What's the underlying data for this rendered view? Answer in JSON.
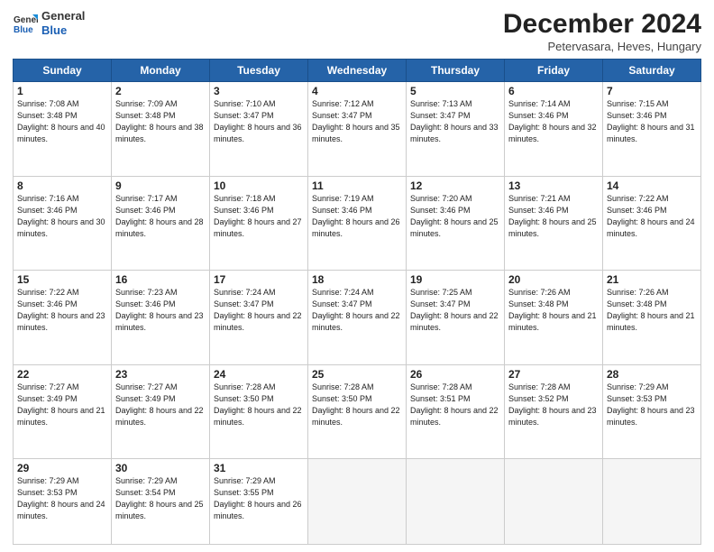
{
  "logo": {
    "line1": "General",
    "line2": "Blue"
  },
  "title": "December 2024",
  "subtitle": "Petervasara, Heves, Hungary",
  "header": {
    "days": [
      "Sunday",
      "Monday",
      "Tuesday",
      "Wednesday",
      "Thursday",
      "Friday",
      "Saturday"
    ]
  },
  "weeks": [
    [
      {
        "day": "1",
        "sunrise": "7:08 AM",
        "sunset": "3:48 PM",
        "daylight": "8 hours and 40 minutes."
      },
      {
        "day": "2",
        "sunrise": "7:09 AM",
        "sunset": "3:48 PM",
        "daylight": "8 hours and 38 minutes."
      },
      {
        "day": "3",
        "sunrise": "7:10 AM",
        "sunset": "3:47 PM",
        "daylight": "8 hours and 36 minutes."
      },
      {
        "day": "4",
        "sunrise": "7:12 AM",
        "sunset": "3:47 PM",
        "daylight": "8 hours and 35 minutes."
      },
      {
        "day": "5",
        "sunrise": "7:13 AM",
        "sunset": "3:47 PM",
        "daylight": "8 hours and 33 minutes."
      },
      {
        "day": "6",
        "sunrise": "7:14 AM",
        "sunset": "3:46 PM",
        "daylight": "8 hours and 32 minutes."
      },
      {
        "day": "7",
        "sunrise": "7:15 AM",
        "sunset": "3:46 PM",
        "daylight": "8 hours and 31 minutes."
      }
    ],
    [
      {
        "day": "8",
        "sunrise": "7:16 AM",
        "sunset": "3:46 PM",
        "daylight": "8 hours and 30 minutes."
      },
      {
        "day": "9",
        "sunrise": "7:17 AM",
        "sunset": "3:46 PM",
        "daylight": "8 hours and 28 minutes."
      },
      {
        "day": "10",
        "sunrise": "7:18 AM",
        "sunset": "3:46 PM",
        "daylight": "8 hours and 27 minutes."
      },
      {
        "day": "11",
        "sunrise": "7:19 AM",
        "sunset": "3:46 PM",
        "daylight": "8 hours and 26 minutes."
      },
      {
        "day": "12",
        "sunrise": "7:20 AM",
        "sunset": "3:46 PM",
        "daylight": "8 hours and 25 minutes."
      },
      {
        "day": "13",
        "sunrise": "7:21 AM",
        "sunset": "3:46 PM",
        "daylight": "8 hours and 25 minutes."
      },
      {
        "day": "14",
        "sunrise": "7:22 AM",
        "sunset": "3:46 PM",
        "daylight": "8 hours and 24 minutes."
      }
    ],
    [
      {
        "day": "15",
        "sunrise": "7:22 AM",
        "sunset": "3:46 PM",
        "daylight": "8 hours and 23 minutes."
      },
      {
        "day": "16",
        "sunrise": "7:23 AM",
        "sunset": "3:46 PM",
        "daylight": "8 hours and 23 minutes."
      },
      {
        "day": "17",
        "sunrise": "7:24 AM",
        "sunset": "3:47 PM",
        "daylight": "8 hours and 22 minutes."
      },
      {
        "day": "18",
        "sunrise": "7:24 AM",
        "sunset": "3:47 PM",
        "daylight": "8 hours and 22 minutes."
      },
      {
        "day": "19",
        "sunrise": "7:25 AM",
        "sunset": "3:47 PM",
        "daylight": "8 hours and 22 minutes."
      },
      {
        "day": "20",
        "sunrise": "7:26 AM",
        "sunset": "3:48 PM",
        "daylight": "8 hours and 21 minutes."
      },
      {
        "day": "21",
        "sunrise": "7:26 AM",
        "sunset": "3:48 PM",
        "daylight": "8 hours and 21 minutes."
      }
    ],
    [
      {
        "day": "22",
        "sunrise": "7:27 AM",
        "sunset": "3:49 PM",
        "daylight": "8 hours and 21 minutes."
      },
      {
        "day": "23",
        "sunrise": "7:27 AM",
        "sunset": "3:49 PM",
        "daylight": "8 hours and 22 minutes."
      },
      {
        "day": "24",
        "sunrise": "7:28 AM",
        "sunset": "3:50 PM",
        "daylight": "8 hours and 22 minutes."
      },
      {
        "day": "25",
        "sunrise": "7:28 AM",
        "sunset": "3:50 PM",
        "daylight": "8 hours and 22 minutes."
      },
      {
        "day": "26",
        "sunrise": "7:28 AM",
        "sunset": "3:51 PM",
        "daylight": "8 hours and 22 minutes."
      },
      {
        "day": "27",
        "sunrise": "7:28 AM",
        "sunset": "3:52 PM",
        "daylight": "8 hours and 23 minutes."
      },
      {
        "day": "28",
        "sunrise": "7:29 AM",
        "sunset": "3:53 PM",
        "daylight": "8 hours and 23 minutes."
      }
    ],
    [
      {
        "day": "29",
        "sunrise": "7:29 AM",
        "sunset": "3:53 PM",
        "daylight": "8 hours and 24 minutes."
      },
      {
        "day": "30",
        "sunrise": "7:29 AM",
        "sunset": "3:54 PM",
        "daylight": "8 hours and 25 minutes."
      },
      {
        "day": "31",
        "sunrise": "7:29 AM",
        "sunset": "3:55 PM",
        "daylight": "8 hours and 26 minutes."
      },
      null,
      null,
      null,
      null
    ]
  ]
}
